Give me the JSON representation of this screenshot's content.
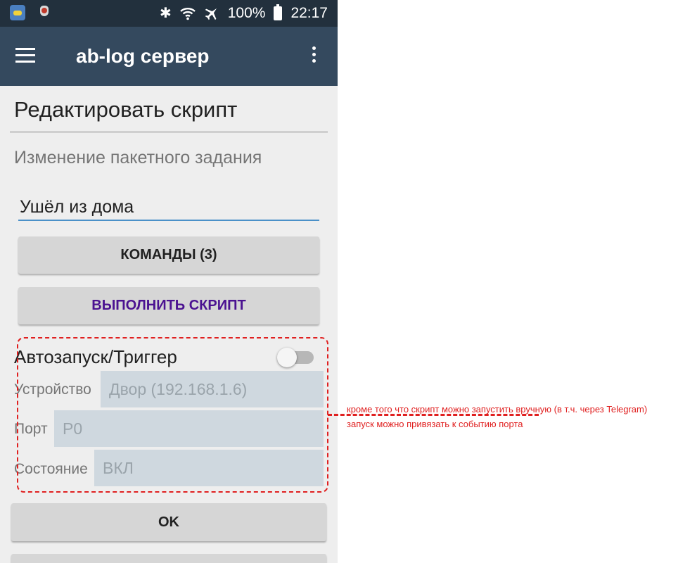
{
  "status_bar": {
    "battery": "100%",
    "time": "22:17",
    "icons": [
      "app-icon",
      "bug-icon",
      "bluetooth-icon",
      "wifi-icon",
      "airplane-icon",
      "battery-icon"
    ]
  },
  "toolbar": {
    "title": "ab-log сервер"
  },
  "page": {
    "title": "Редактировать скрипт",
    "subtitle": "Изменение пакетного задания",
    "name_value": "Ушёл из дома"
  },
  "buttons": {
    "commands": "КОМАНДЫ (3)",
    "run": "ВЫПОЛНИТЬ СКРИПТ",
    "ok": "OK"
  },
  "trigger": {
    "label": "Автозапуск/Триггер",
    "enabled": false,
    "fields": {
      "device_label": "Устройство",
      "device_value": "Двор (192.168.1.6)",
      "port_label": "Порт",
      "port_value": "P0",
      "state_label": "Состояние",
      "state_value": "ВКЛ"
    }
  },
  "annotation": {
    "line1": "кроме того что скрипт можно запустить вручную (в т.ч. через Telegram)",
    "line2": "запуск можно привязать к событию порта"
  },
  "colors": {
    "status_bar": "#22303d",
    "toolbar": "#34495e",
    "accent": "#4a90c8",
    "run_text": "#4b1291",
    "annotation": "#e02020"
  }
}
